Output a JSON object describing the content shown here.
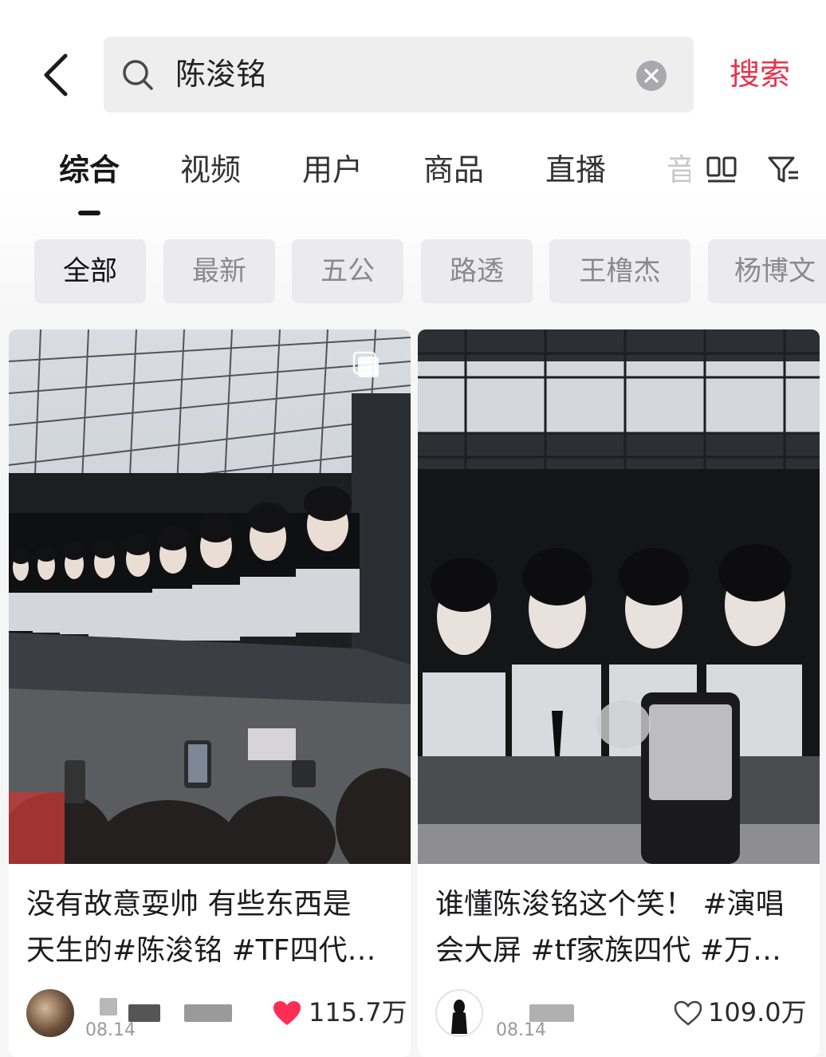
{
  "search": {
    "query": "陈浚铭",
    "submit_label": "搜索"
  },
  "tabs": [
    "综合",
    "视频",
    "用户",
    "商品",
    "直播",
    "音"
  ],
  "chips": [
    "全部",
    "最新",
    "五公",
    "路透",
    "王橹杰",
    "杨博文"
  ],
  "icons": {
    "back": "chevron-left-icon",
    "search": "search-icon",
    "clear": "close-circle-icon",
    "layout": "grid-view-icon",
    "filter": "filter-icon",
    "like_filled": "heart-filled-icon",
    "like_outline": "heart-outline-icon"
  },
  "colors": {
    "accent": "#e8334a",
    "heart": "#ff2d55"
  },
  "cards": [
    {
      "title_line1": "没有故意耍帅 有些东西是",
      "title_line2": "天生的#陈浚铭 #TF四代…",
      "date": "08.14",
      "likes": "115.7万",
      "liked": true
    },
    {
      "title_line1": "谁懂陈浚铭这个笑！ #演唱",
      "title_line2": "会大屏 #tf家族四代  #万…",
      "date": "08.14",
      "likes": "109.0万",
      "liked": false
    }
  ]
}
